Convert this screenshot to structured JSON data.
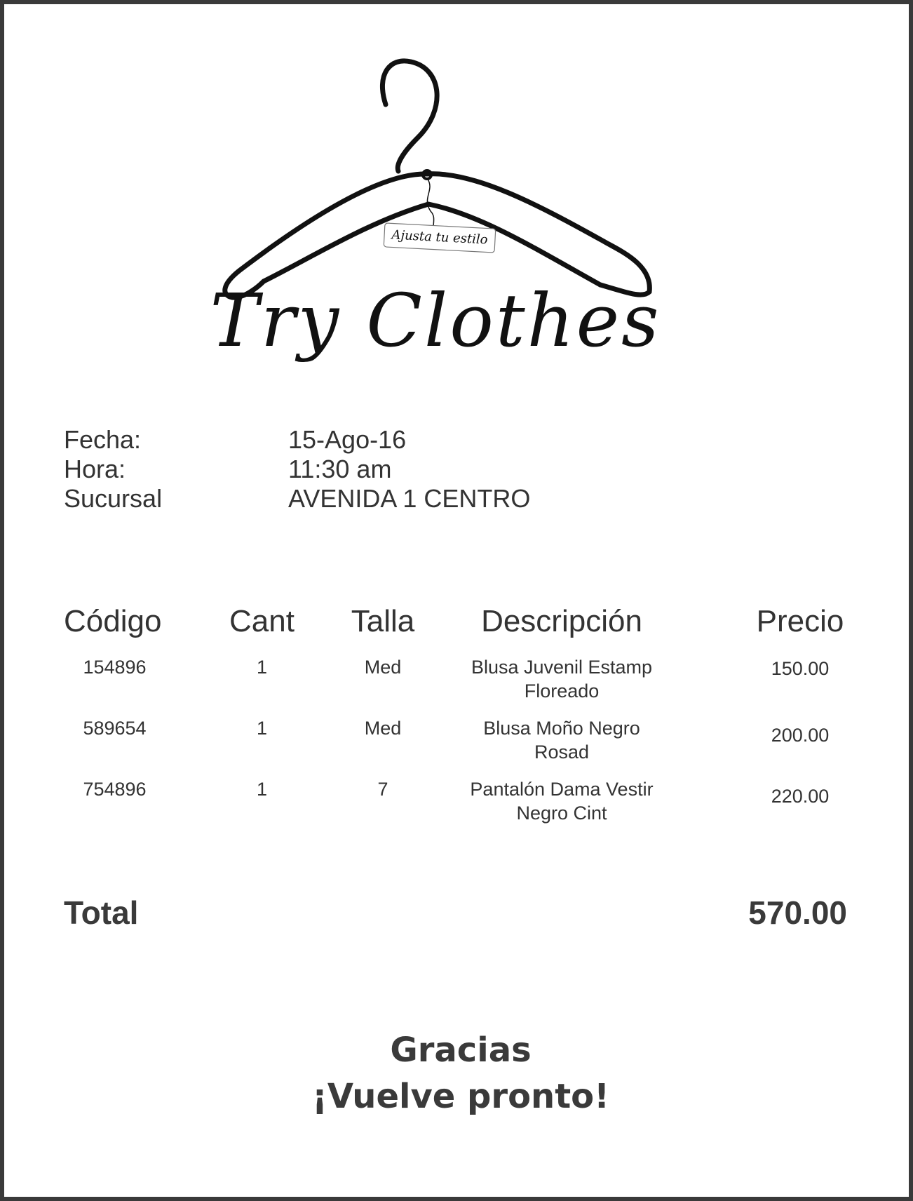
{
  "logo": {
    "brand": "Try Clothes",
    "tagline": "Ajusta tu estilo"
  },
  "info": {
    "date_label": "Fecha:",
    "date_value": "15-Ago-16",
    "time_label": "Hora:",
    "time_value": "11:30 am",
    "branch_label": "Sucursal",
    "branch_value": "AVENIDA 1 CENTRO"
  },
  "table": {
    "headers": {
      "code": "Código",
      "qty": "Cant",
      "size": "Talla",
      "desc": "Descripción",
      "price": "Precio"
    },
    "rows": [
      {
        "code": "154896",
        "qty": "1",
        "size": "Med",
        "desc_line1": "Blusa Juvenil Estamp",
        "desc_line2": "Floreado",
        "price": "150.00"
      },
      {
        "code": "589654",
        "qty": "1",
        "size": "Med",
        "desc_line1": "Blusa Moño Negro",
        "desc_line2": "Rosad",
        "price": "200.00"
      },
      {
        "code": "754896",
        "qty": "1",
        "size": "7",
        "desc_line1": "Pantalón Dama Vestir",
        "desc_line2": "Negro Cint",
        "price": "220.00"
      }
    ]
  },
  "total": {
    "label": "Total",
    "value": "570.00"
  },
  "footer": {
    "line1": "Gracias",
    "line2": "¡Vuelve pronto!"
  },
  "colors": {
    "text": "#333333",
    "border": "#3a3a3a",
    "logo": "#111111"
  },
  "icons": {
    "logo_graphic": "hanger-icon"
  }
}
